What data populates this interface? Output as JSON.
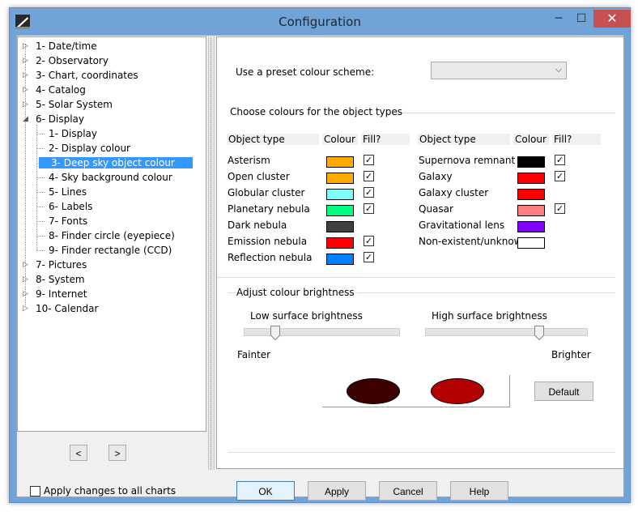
{
  "window": {
    "title": "Configuration"
  },
  "tree": {
    "items": [
      {
        "label": "1- Date/time",
        "level": 0,
        "arrow": "▷"
      },
      {
        "label": "2- Observatory",
        "level": 0,
        "arrow": "▷"
      },
      {
        "label": "3- Chart, coordinates",
        "level": 0,
        "arrow": "▷"
      },
      {
        "label": "4- Catalog",
        "level": 0,
        "arrow": "▷"
      },
      {
        "label": "5- Solar System",
        "level": 0,
        "arrow": "▷"
      },
      {
        "label": "6- Display",
        "level": 0,
        "arrow": "◢"
      },
      {
        "label": "1- Display",
        "level": 1
      },
      {
        "label": "2- Display colour",
        "level": 1
      },
      {
        "label": "3- Deep sky object colour",
        "level": 1,
        "selected": true
      },
      {
        "label": "4- Sky background colour",
        "level": 1
      },
      {
        "label": "5- Lines",
        "level": 1
      },
      {
        "label": "6- Labels",
        "level": 1
      },
      {
        "label": "7- Fonts",
        "level": 1
      },
      {
        "label": "8- Finder circle (eyepiece)",
        "level": 1
      },
      {
        "label": "9- Finder rectangle (CCD)",
        "level": 1
      },
      {
        "label": "7- Pictures",
        "level": 0,
        "arrow": "▷"
      },
      {
        "label": "8- System",
        "level": 0,
        "arrow": "▷"
      },
      {
        "label": "9- Internet",
        "level": 0,
        "arrow": "▷"
      },
      {
        "label": "10- Calendar",
        "level": 0,
        "arrow": "▷"
      }
    ],
    "prev_label": "<",
    "next_label": ">"
  },
  "preset": {
    "label": "Use a preset colour scheme:",
    "value": ""
  },
  "object_group": {
    "title": "Choose colours for the object types",
    "headers": {
      "type": "Object type",
      "colour": "Colour",
      "fill": "Fill?"
    },
    "left": [
      {
        "name": "Asterism",
        "color": "#ffaa00",
        "fill": true
      },
      {
        "name": "Open cluster",
        "color": "#ffaa00",
        "fill": true
      },
      {
        "name": "Globular cluster",
        "color": "#80ffff",
        "fill": true
      },
      {
        "name": "Planetary nebula",
        "color": "#00ff80",
        "fill": true
      },
      {
        "name": "Dark nebula",
        "color": "#404040",
        "fill": false
      },
      {
        "name": "Emission nebula",
        "color": "#ff0000",
        "fill": true
      },
      {
        "name": "Reflection nebula",
        "color": "#0080ff",
        "fill": true
      }
    ],
    "right": [
      {
        "name": "Supernova remnant",
        "color": "#000000",
        "fill": true
      },
      {
        "name": "Galaxy",
        "color": "#ff0000",
        "fill": true
      },
      {
        "name": "Galaxy cluster",
        "color": "#ff0000",
        "fill": false
      },
      {
        "name": "Quasar",
        "color": "#ff8080",
        "fill": true
      },
      {
        "name": "Gravitational lens",
        "color": "#8000ff",
        "fill": false
      },
      {
        "name": "Non-existent/unknown",
        "color": "#ffffff",
        "fill": false
      }
    ]
  },
  "brightness": {
    "title": "Adjust colour brightness",
    "low_label": "Low surface brightness",
    "high_label": "High surface brightness",
    "low_value": 0.2,
    "high_value": 0.7,
    "fainter": "Fainter",
    "brighter": "Brighter",
    "preview_low_color": "#3d0000",
    "preview_high_color": "#b30000",
    "default_label": "Default"
  },
  "footer": {
    "apply_all_label": "Apply changes to all charts",
    "ok": "OK",
    "apply": "Apply",
    "cancel": "Cancel",
    "help": "Help"
  }
}
